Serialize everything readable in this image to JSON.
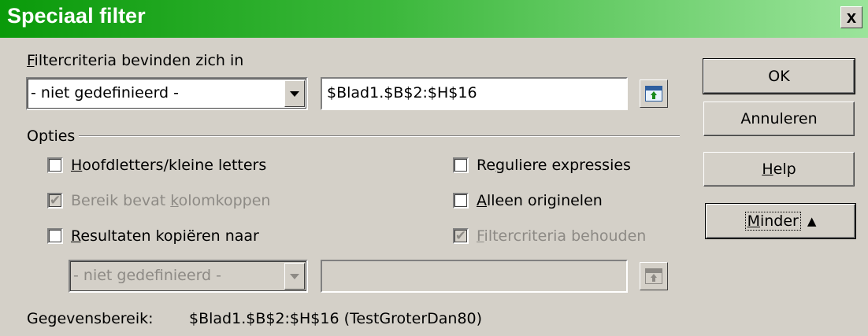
{
  "window": {
    "title": "Speciaal filter",
    "close_label": "x"
  },
  "criteria": {
    "label_first": "F",
    "label_rest": "iltercriteria bevinden zich in",
    "named_range": "- niet gedefinieerd -",
    "range_value": "$Blad1.$B$2:$H$16"
  },
  "options": {
    "section_label": "Opties",
    "case_sensitive": {
      "pre": "",
      "key": "H",
      "post": "oofdletters/kleine letters",
      "checked": false
    },
    "header_row": {
      "pre": "Bereik bevat ",
      "key": "k",
      "post": "olomkoppen",
      "checked": true,
      "disabled": true
    },
    "copy_results": {
      "pre": "",
      "key": "R",
      "post": "esultaten kopiëren naar",
      "checked": false
    },
    "regex": {
      "pre": "Re",
      "key": "g",
      "post": "uliere expressies",
      "checked": false
    },
    "unique": {
      "pre": "",
      "key": "A",
      "post": "lleen originelen",
      "checked": false
    },
    "keep_criteria": {
      "pre": "",
      "key": "F",
      "post": "iltercriteria behouden",
      "checked": true,
      "disabled": true
    },
    "copy_named_range": "- niet gedefinieerd -",
    "copy_target": ""
  },
  "data_range": {
    "label": "Gegevensbereik:",
    "value": "$Blad1.$B$2:$H$16 (TestGroterDan80)"
  },
  "buttons": {
    "ok": "OK",
    "cancel": "Annuleren",
    "help_key": "H",
    "help_rest": "elp",
    "less_key": "M",
    "less_rest": "inder",
    "less_icon": "double-up-arrow-icon"
  }
}
